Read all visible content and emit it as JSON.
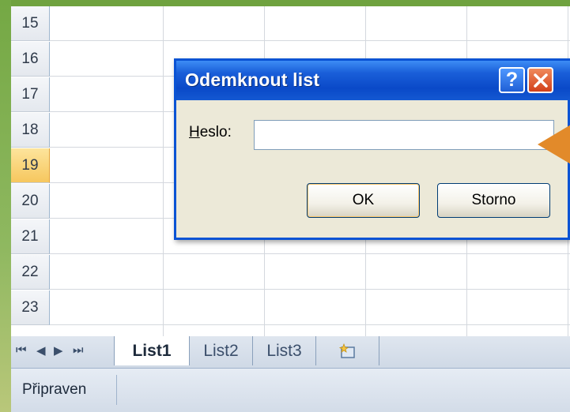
{
  "spreadsheet": {
    "rows": [
      "15",
      "16",
      "17",
      "18",
      "19",
      "20",
      "21",
      "22",
      "23"
    ],
    "selected_row": "19"
  },
  "dialog": {
    "title": "Odemknout list",
    "help_label": "?",
    "field_label_underlined": "H",
    "field_label_rest": "eslo:",
    "password_value": "",
    "ok_label": "OK",
    "cancel_label": "Storno"
  },
  "sheet_tabs": {
    "nav": [
      "⏮",
      "◀",
      "▶",
      "⏭"
    ],
    "tabs": [
      "List1",
      "List2",
      "List3"
    ],
    "active": "List1",
    "insert_icon": "insert-sheet-icon"
  },
  "status_bar": {
    "status_text": "Připraven"
  },
  "colors": {
    "accent_green": "#6a9a3c",
    "titlebar_blue": "#0a49c8",
    "close_red": "#d2401a",
    "arrow_orange": "#e28a2a",
    "selected_row": "#f6c75e"
  }
}
